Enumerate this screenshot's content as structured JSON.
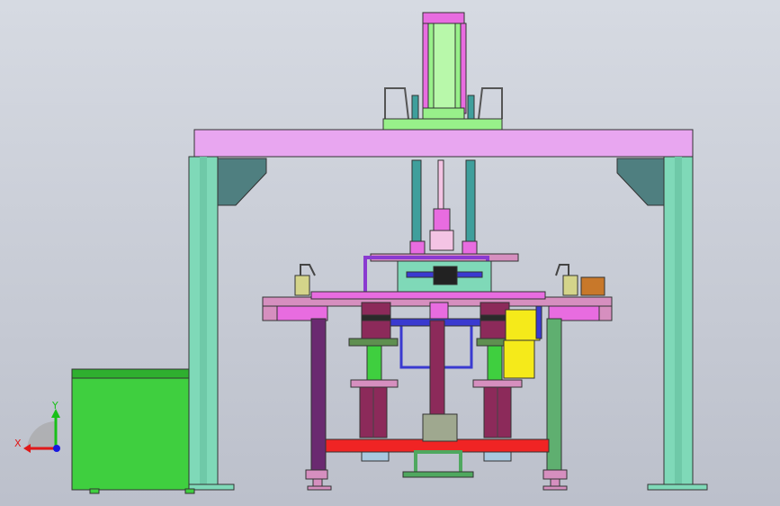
{
  "colors": {
    "background_top": "#d3d7df",
    "background_bottom": "#b9bdc8",
    "frame_post": "#7fd9b8",
    "frame_beam": "#e8a6f0",
    "gusset": "#4f7f80",
    "cylinder": "#98f08a",
    "cylinder_rod": "#3f9f9c",
    "cabinet": "#3fcf3f",
    "table_plate": "#d68fbf",
    "magenta_block": "#e86ce0",
    "red_beam": "#f02424",
    "purple_leg": "#6a2a70",
    "green_leg": "#5faf70",
    "blue_frame": "#3a3ad0",
    "yellow_motor": "#f5ea1a",
    "maroon_stack": "#8c2a5a"
  },
  "axis_triad": {
    "x_label": "X",
    "y_label": "Y",
    "x_color": "#e01818",
    "y_color": "#18c018",
    "z_color": "#1818e0"
  }
}
